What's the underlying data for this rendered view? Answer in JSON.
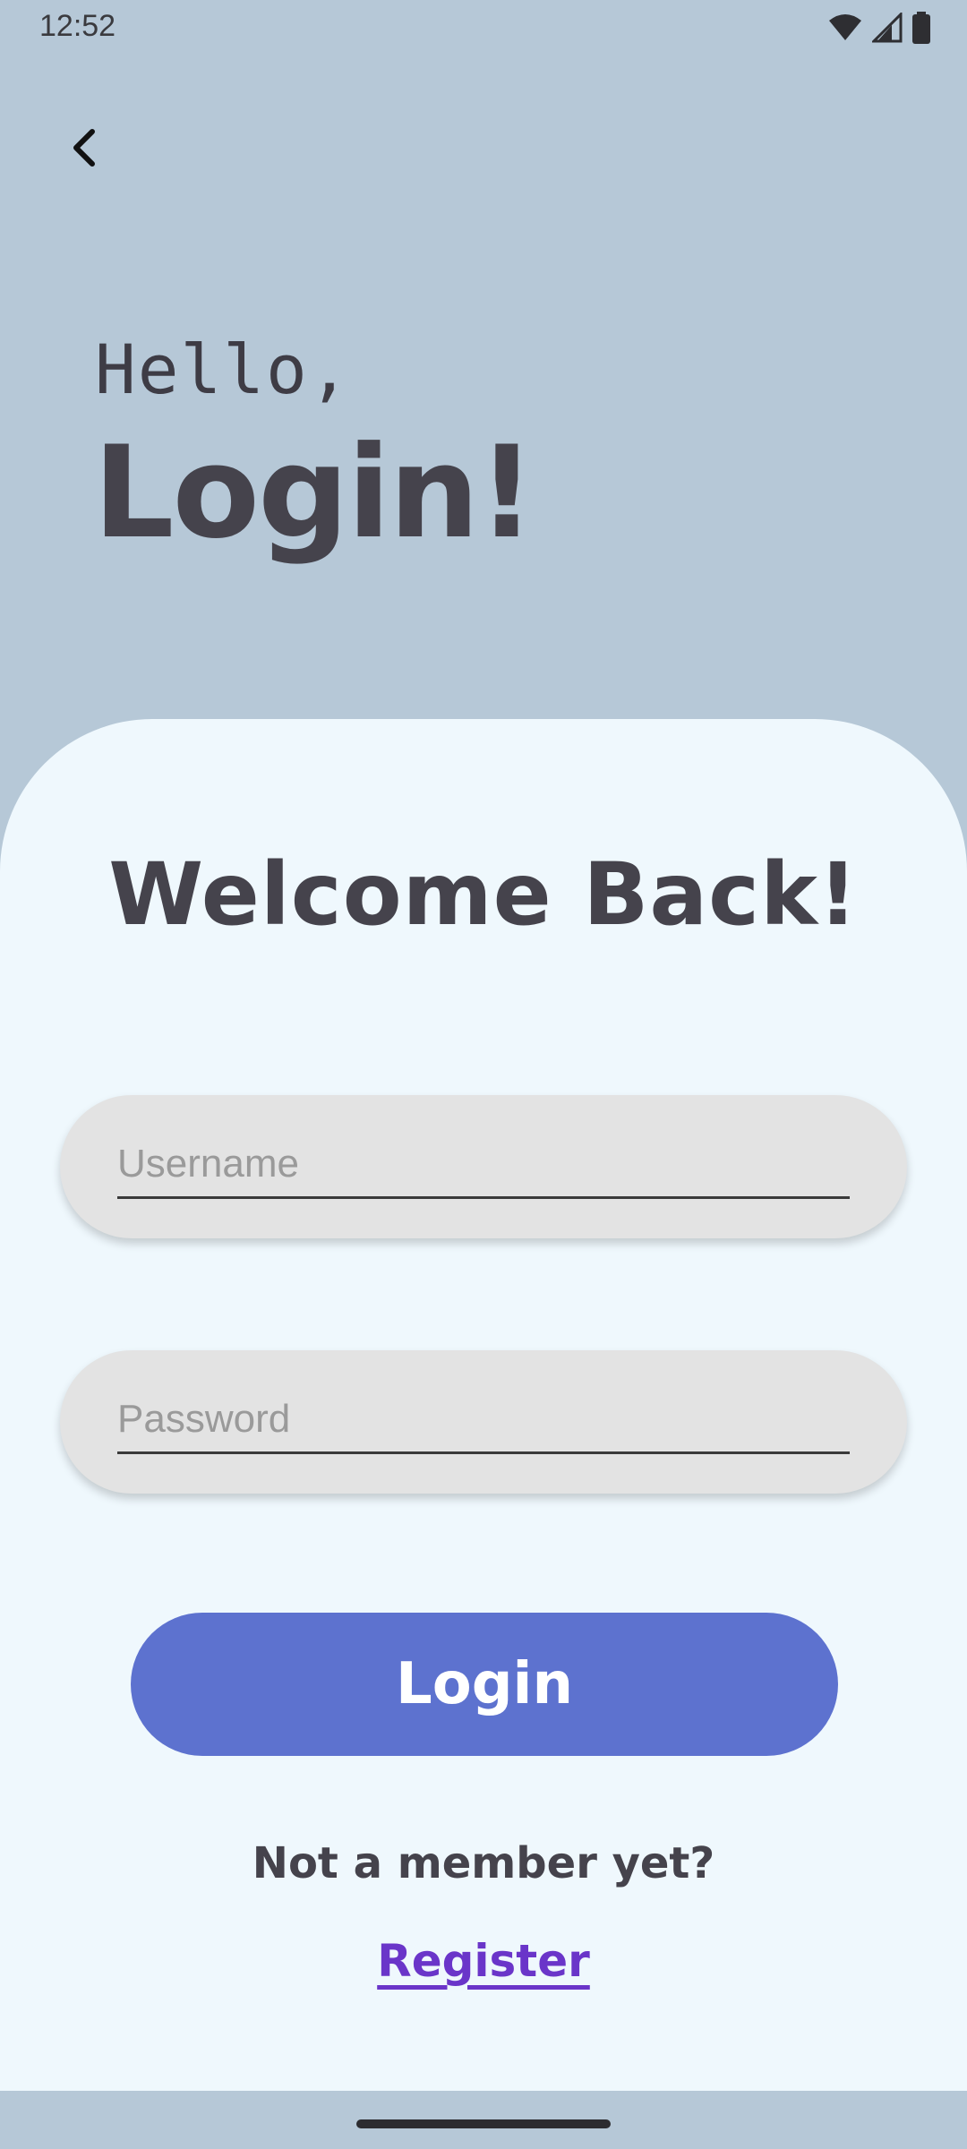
{
  "status_bar": {
    "time": "12:52",
    "icons": [
      "wifi-icon",
      "cell-signal-icon",
      "battery-icon"
    ]
  },
  "header": {
    "back_icon": "chevron-left-icon",
    "greeting": "Hello,",
    "title": "Login!"
  },
  "card": {
    "heading": "Welcome Back!",
    "username": {
      "value": "",
      "placeholder": "Username"
    },
    "password": {
      "value": "",
      "placeholder": "Password"
    },
    "login_label": "Login",
    "prompt": "Not a member yet?",
    "register_label": "Register"
  },
  "colors": {
    "background": "#b6c8d7",
    "card": "#eff8fd",
    "button": "#5d72cf",
    "link": "#6a35c9",
    "text": "#45434c"
  }
}
